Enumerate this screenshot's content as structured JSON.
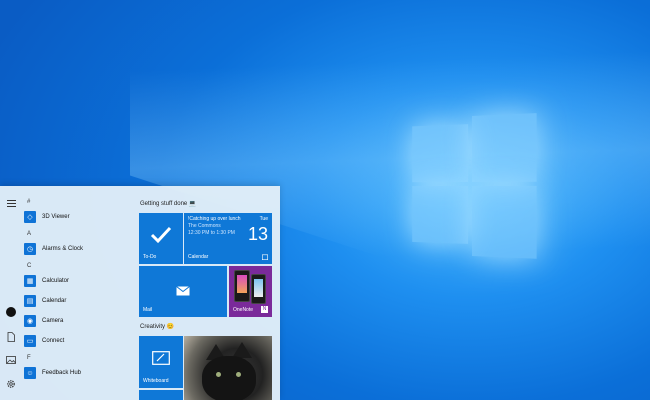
{
  "desktop": {
    "wallpaper": "windows-10-light-hero",
    "accent": "#0f78d7"
  },
  "start_menu": {
    "rail": {
      "icons": [
        "hamburger-icon",
        "user-icon",
        "document-icon",
        "pictures-icon",
        "settings-icon"
      ]
    },
    "app_list": {
      "sections": [
        {
          "letter": "#",
          "apps": [
            {
              "label": "3D Viewer",
              "icon": "cube-icon"
            }
          ]
        },
        {
          "letter": "A",
          "apps": [
            {
              "label": "Alarms & Clock",
              "icon": "alarm-icon"
            }
          ]
        },
        {
          "letter": "C",
          "apps": [
            {
              "label": "Calculator",
              "icon": "calculator-icon"
            },
            {
              "label": "Calendar",
              "icon": "calendar-icon"
            },
            {
              "label": "Camera",
              "icon": "camera-icon"
            },
            {
              "label": "Connect",
              "icon": "connect-icon"
            }
          ]
        },
        {
          "letter": "F",
          "apps": [
            {
              "label": "Feedback Hub",
              "icon": "feedback-icon"
            }
          ]
        }
      ]
    },
    "tiles": {
      "group1_title": "Getting stuff done 💻",
      "todo_label": "To-Do",
      "calendar": {
        "event": "!Catching up over lunch",
        "location": "The Commons",
        "time": "12:30 PM to 1:30 PM",
        "day": "Tue",
        "date": "13",
        "label": "Calendar"
      },
      "mail_label": "Mail",
      "onenote_label": "OneNote",
      "group2_title": "Creativity 😊",
      "whiteboard_label": "Whiteboard"
    }
  }
}
